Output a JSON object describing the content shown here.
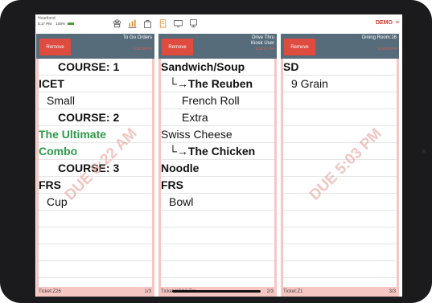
{
  "status": {
    "store_name": "Heartland",
    "time": "5:17 PM",
    "battery": "100%"
  },
  "toolbar": {
    "icons": [
      "chef-hat-icon",
      "chart-icon",
      "bag-icon",
      "receipt-icon",
      "screen-icon",
      "monitor-icon"
    ],
    "demo_label": "DEMO",
    "menu_icon": "≡"
  },
  "columns": [
    {
      "title_line1": "To Go Orders",
      "title_line2": "",
      "subtitle": "5:22:35 PM",
      "remove_label": "Remove",
      "due_text": "DUE 8:22 AM",
      "footer_ticket": "Ticket:Z26",
      "footer_page": "1/3",
      "items": [
        {
          "text": "COURSE: 1",
          "style": "bold",
          "indent": 24
        },
        {
          "text": "ICET",
          "style": "bold",
          "indent": 0
        },
        {
          "text": "Small",
          "style": "",
          "indent": 10
        },
        {
          "text": "COURSE: 2",
          "style": "bold",
          "indent": 24
        },
        {
          "text": "The Ultimate",
          "style": "green",
          "indent": 0
        },
        {
          "text": "Combo",
          "style": "green",
          "indent": 0
        },
        {
          "text": "COURSE: 3",
          "style": "bold",
          "indent": 24
        },
        {
          "text": "FRS",
          "style": "bold",
          "indent": 0
        },
        {
          "text": "Cup",
          "style": "",
          "indent": 10
        }
      ]
    },
    {
      "title_line1": "Drive Thru",
      "title_line2": "Kiosk User",
      "subtitle": "5:22:37 PM",
      "remove_label": "Remove",
      "due_text": "",
      "footer_ticket": "Ticket:KSK2 Tim",
      "footer_page": "2/3",
      "items": [
        {
          "text": "Sandwich/Soup",
          "style": "bold",
          "indent": 0
        },
        {
          "text": "└→The Reuben",
          "style": "bold",
          "indent": 10
        },
        {
          "text": "French Roll",
          "style": "",
          "indent": 26
        },
        {
          "text": "Extra",
          "style": "",
          "indent": 26
        },
        {
          "text": "Swiss Cheese",
          "style": "",
          "indent": 0
        },
        {
          "text": "└→The Chicken",
          "style": "bold",
          "indent": 10
        },
        {
          "text": "Noodle",
          "style": "bold",
          "indent": 0
        },
        {
          "text": "FRS",
          "style": "bold",
          "indent": 0
        },
        {
          "text": "Bowl",
          "style": "",
          "indent": 10
        }
      ]
    },
    {
      "title_line1": "Dining Room:16",
      "title_line2": "",
      "subtitle": "5:19:05 PM",
      "remove_label": "Remove",
      "due_text": "DUE 5:03 PM",
      "footer_ticket": "Ticket:Z1",
      "footer_page": "3/3",
      "items": [
        {
          "text": "SD",
          "style": "bold",
          "indent": 0
        },
        {
          "text": "9 Grain",
          "style": "",
          "indent": 10
        }
      ]
    }
  ]
}
